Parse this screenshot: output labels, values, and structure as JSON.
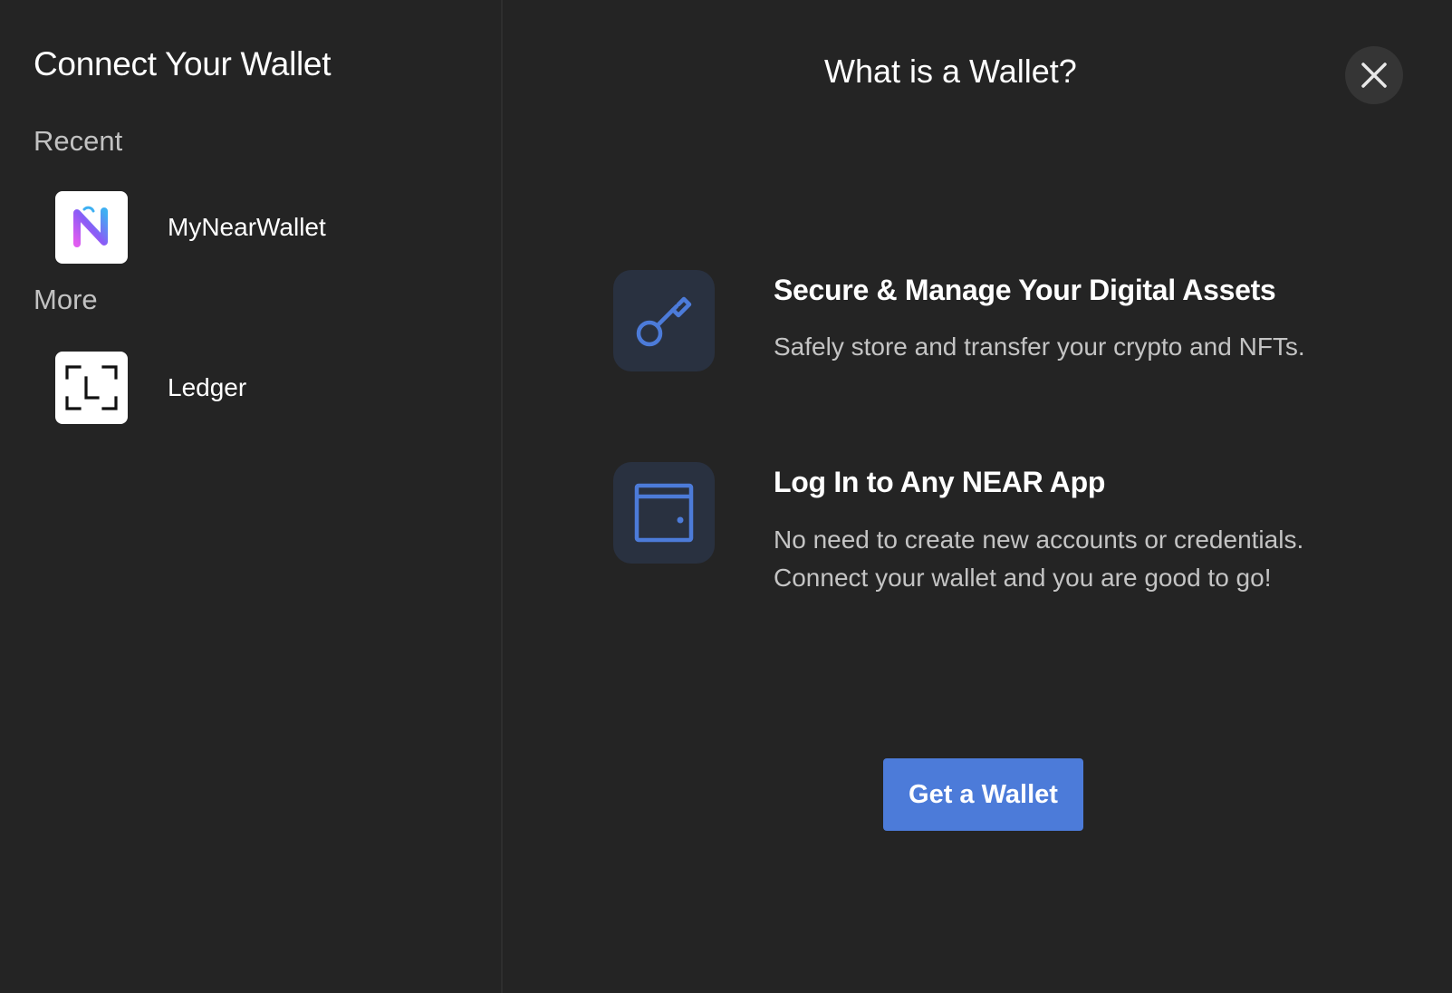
{
  "sidebar": {
    "title": "Connect Your Wallet",
    "recent_label": "Recent",
    "more_label": "More",
    "recent_wallets": [
      {
        "name": "MyNearWallet",
        "icon": "mynearwallet-logo-icon"
      }
    ],
    "more_wallets": [
      {
        "name": "Ledger",
        "icon": "ledger-logo-icon"
      }
    ]
  },
  "main": {
    "title": "What is a Wallet?",
    "close_icon": "close-icon",
    "features": [
      {
        "icon": "key-icon",
        "title": "Secure & Manage Your Digital Assets",
        "description": "Safely store and transfer your crypto and NFTs."
      },
      {
        "icon": "wallet-icon",
        "title": "Log In to Any NEAR App",
        "description": "No need to create new accounts or credentials. Connect your wallet and you are good to go!"
      }
    ],
    "cta_label": "Get a Wallet"
  },
  "colors": {
    "background": "#242424",
    "accent": "#4c7bd9",
    "icon_tile": "#293140",
    "icon_stroke": "#4c7bd9"
  }
}
